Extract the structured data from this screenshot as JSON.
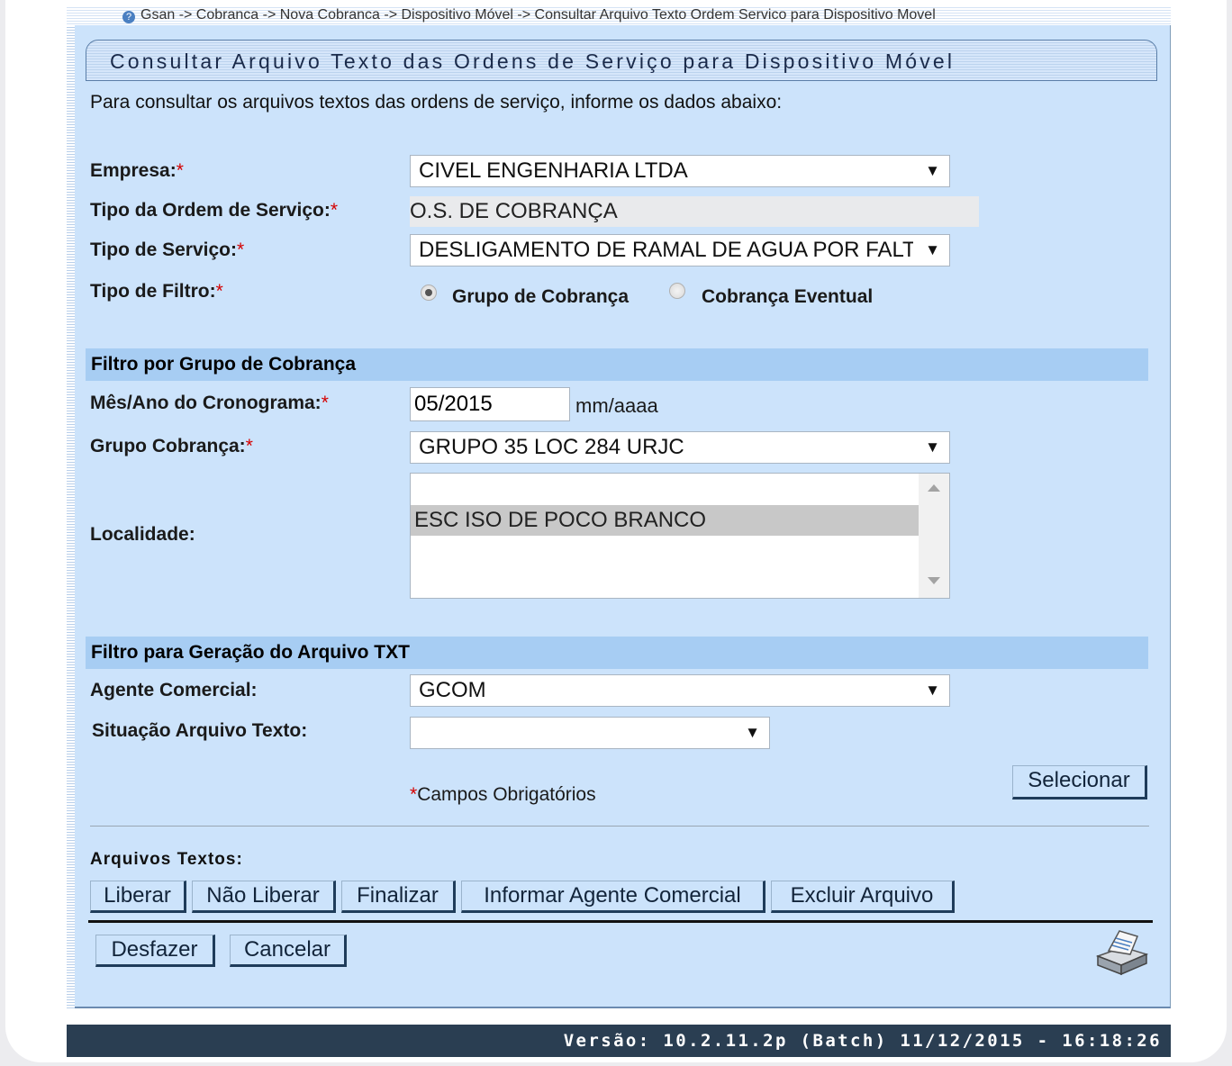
{
  "breadcrumb": "Gsan -> Cobranca -> Nova Cobranca -> Dispositivo Móvel -> Consultar Arquivo Texto Ordem Servico para Dispositivo Movel",
  "title": "Consultar Arquivo Texto das Ordens de Serviço para Dispositivo Móvel",
  "intro": "Para consultar os arquivos textos das ordens de serviço, informe os dados abaixo:",
  "required_marker": "*",
  "form": {
    "empresa": {
      "label": "Empresa:",
      "value": "CIVEL ENGENHARIA LTDA"
    },
    "tipo_ordem": {
      "label": "Tipo da Ordem de Serviço:",
      "value": "O.S. DE COBRANÇA"
    },
    "tipo_servico": {
      "label": "Tipo de Serviço:",
      "value": "DESLIGAMENTO DE RAMAL DE AGUA POR FALTA DE PAGAMENTO"
    },
    "tipo_filtro": {
      "label": "Tipo de Filtro:",
      "option1": "Grupo de Cobrança",
      "option2": "Cobrança Eventual",
      "selected": "Grupo de Cobrança"
    }
  },
  "section_grupo": "Filtro por Grupo de Cobrança",
  "grupo": {
    "mes_ano_label": "Mês/Ano do Cronograma:",
    "mes_ano_value": "05/2015",
    "mes_ano_hint": "mm/aaaa",
    "grupo_label": "Grupo Cobrança:",
    "grupo_value": "GRUPO 35 LOC 284 URJC",
    "localidade_label": "Localidade:",
    "localidade_items": [
      "ESC ISO DE POCO BRANCO"
    ]
  },
  "section_txt": "Filtro para Geração do Arquivo TXT",
  "txt": {
    "agente_label": "Agente Comercial:",
    "agente_value": "GCOM",
    "situacao_label": "Situação Arquivo Texto:",
    "situacao_value": ""
  },
  "required_note": "Campos Obrigatórios",
  "selecionar": "Selecionar",
  "arquivos_label": "Arquivos Textos:",
  "actions": {
    "liberar": "Liberar",
    "nao_liberar": "Não Liberar",
    "finalizar": "Finalizar",
    "informar_agente": "Informar Agente Comercial",
    "excluir": "Excluir Arquivo",
    "desfazer": "Desfazer",
    "cancelar": "Cancelar"
  },
  "footer": "Versão: 10.2.11.2p (Batch) 11/12/2015 - 16:18:26"
}
